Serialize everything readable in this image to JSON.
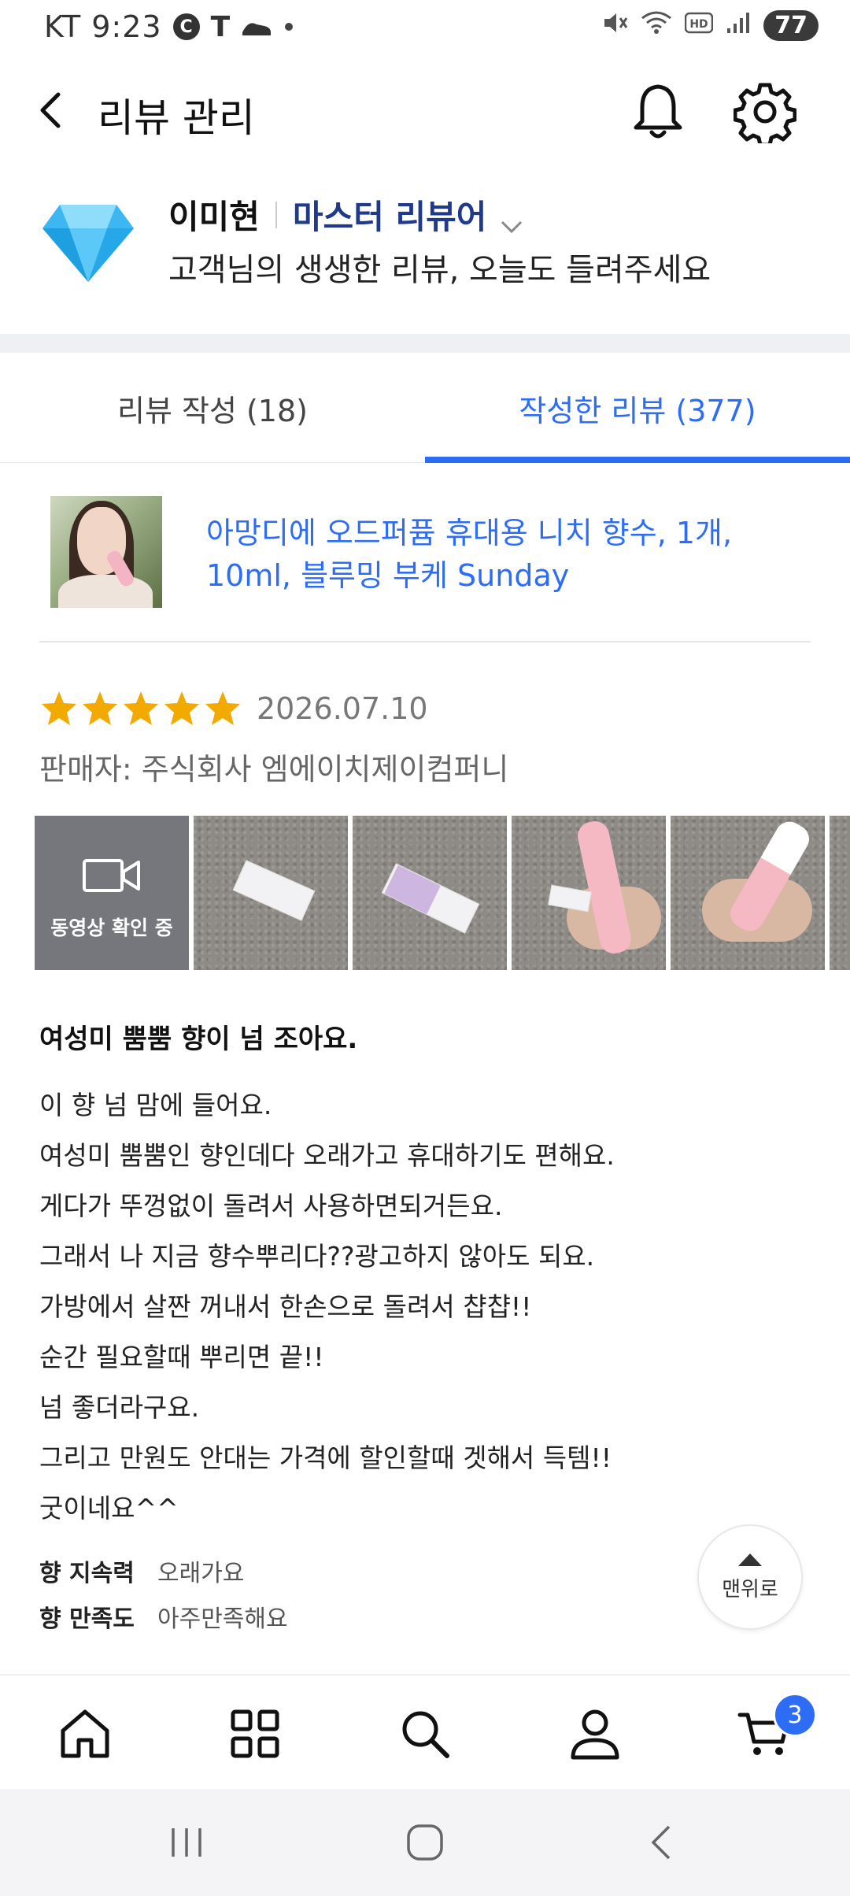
{
  "status_bar": {
    "carrier_time": "KT 9:23",
    "icons": [
      "c-circle-icon",
      "t-icon",
      "shoe-icon",
      "dot-icon"
    ],
    "right_icons": [
      "mute-icon",
      "wifi-icon",
      "hd-icon",
      "signal-icon"
    ],
    "battery": "77"
  },
  "header": {
    "title": "리뷰 관리",
    "icons": [
      "back-icon",
      "bell-icon",
      "gear-icon"
    ]
  },
  "profile": {
    "name": "이미현",
    "grade": "마스터 리뷰어",
    "message": "고객님의 생생한 리뷰, 오늘도 들려주세요"
  },
  "tabs": [
    {
      "label": "리뷰 작성 (18)",
      "selected": false
    },
    {
      "label": "작성한 리뷰 (377)",
      "selected": true
    }
  ],
  "product": {
    "name": "아망디에 오드퍼퓸 휴대용 니치 향수, 1개, 10ml, 블루밍 부케 Sunday"
  },
  "review": {
    "rating": 5,
    "date": "2026.07.10",
    "seller": "판매자: 주식회사 엠에이치제이컴퍼니",
    "video_label": "동영상 확인 중",
    "title": "여성미 뿜뿜 향이 넘 조아요.",
    "lines": [
      "이 향 넘 맘에 들어요.",
      "여성미 뿜뿜인 향인데다 오래가고 휴대하기도 편해요.",
      "게다가 뚜껑없이 돌려서 사용하면되거든요.",
      "그래서 나 지금 향수뿌리다??광고하지 않아도 되요.",
      "가방에서 살짠 꺼내서 한손으로 돌려서 챱챱!!",
      "순간 필요할때 뿌리면 끝!!",
      "넘 좋더라구요.",
      "그리고 만원도 안대는 가격에 할인할때 겟해서 득템!!",
      "굿이네요^^"
    ],
    "attributes": [
      {
        "key": "향 지속력",
        "value": "오래가요"
      },
      {
        "key": "향 만족도",
        "value": "아주만족해요"
      }
    ]
  },
  "top_button": {
    "label": "맨위로"
  },
  "bottom_nav": {
    "items": [
      "home-icon",
      "category-icon",
      "search-icon",
      "account-icon",
      "cart-icon"
    ],
    "cart_count": "3"
  },
  "colors": {
    "accent": "#2d6df6",
    "grade": "#1f3a8a",
    "star": "#f2a900"
  }
}
